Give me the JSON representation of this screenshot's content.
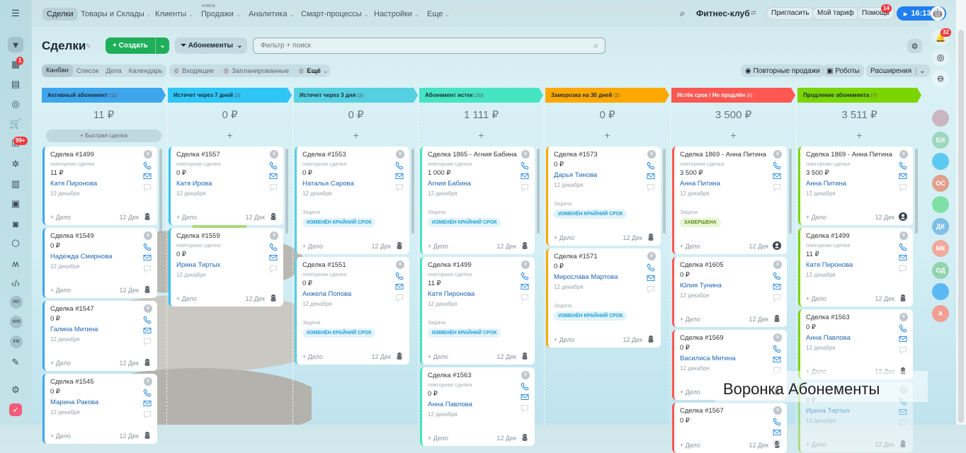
{
  "nav": {
    "items": [
      "Сделки",
      "Товары и Склады",
      "Клиенты",
      "Продажи",
      "Аналитика",
      "Смарт-процессы",
      "Настройки",
      "Еще"
    ],
    "new_tag": "НОВОЕ"
  },
  "header": {
    "org": "Фитнес-клуб",
    "invite": "Пригласить",
    "tariff": "Мой тариф",
    "help": "Помощь",
    "help_badge": "14",
    "time": "16:13",
    "bell_badge": "32"
  },
  "sidebar_left": {
    "badge1": "1",
    "badge2": "99+",
    "users": [
      "MO",
      "WW",
      "KM"
    ]
  },
  "sidebar_right": {
    "avatars": [
      {
        "text": "",
        "color": "#c9b6c0"
      },
      {
        "text": "ЕИ",
        "color": "#9ed6c0"
      },
      {
        "text": "",
        "color": "#5ec9f0"
      },
      {
        "text": "ОС",
        "color": "#e2a08c"
      },
      {
        "text": "",
        "color": "#7fe0a7"
      },
      {
        "text": "ДК",
        "color": "#7fbfe6"
      },
      {
        "text": "МК",
        "color": "#f0a99e"
      },
      {
        "text": "ОД",
        "color": "#93d3b0"
      },
      {
        "text": "",
        "color": "#5cb8f0"
      },
      {
        "text": "А",
        "color": "#f29e92"
      }
    ]
  },
  "toolbar": {
    "title": "Сделки",
    "create": "Создать",
    "funnel": "Абонементы",
    "search_placeholder": "Фильтр + поиск",
    "views": [
      "Канбан",
      "Список",
      "Дела",
      "Календарь"
    ],
    "counters": [
      {
        "n": "0",
        "label": "Входящие"
      },
      {
        "n": "0",
        "label": "Запланированные"
      },
      {
        "n": "0",
        "label": "Ещё"
      }
    ],
    "repeat_sales": "Повторные продажи",
    "robots": "Роботы",
    "extensions": "Расширения"
  },
  "columns": [
    {
      "title": "Активный абонемент",
      "count": "(11)",
      "color": "#3ea6ec",
      "text_color": "#1a2a3a",
      "total": "11 ₽",
      "quick": "+  Быстрая сделка",
      "cards": [
        {
          "title": "Сделка #1499",
          "sub": "повторная сделка",
          "amount": "11 ₽",
          "name": "Катя Пиронова",
          "date": "12 декабря"
        },
        {
          "title": "Сделка #1549",
          "amount": "0 ₽",
          "name": "Надежда Смирнова",
          "date": "12 декабря"
        },
        {
          "title": "Сделка #1547",
          "amount": "0 ₽",
          "name": "Галина Митина",
          "date": "12 декабря"
        },
        {
          "title": "Сделка #1545",
          "amount": "0 ₽",
          "name": "Марина Ракова",
          "date": "12 декабря"
        }
      ]
    },
    {
      "title": "Истечет через 7 дней",
      "count": "(2)",
      "color": "#2fc6f6",
      "text_color": "#1a2a3a",
      "total": "0 ₽",
      "cards": [
        {
          "title": "Сделка #1557",
          "sub": "повторная сделка",
          "amount": "0 ₽",
          "name": "Катя Ирова",
          "date": "12 декабря"
        },
        {
          "title": "Сделка #1559",
          "sub": "повторная сделка",
          "amount": "0 ₽",
          "name": "Ирина Тиртых",
          "date": "12 декабря"
        }
      ]
    },
    {
      "title": "Истечет через 3 дня",
      "count": "(2)",
      "color": "#55d0e0",
      "text_color": "#1a2a3a",
      "total": "0 ₽",
      "cards": [
        {
          "title": "Сделка #1553",
          "sub": "повторная сделка",
          "amount": "0 ₽",
          "name": "Наталья Сарова",
          "date": "12 декабря",
          "task_label": "Задача",
          "task": "ИЗМЕНЁН КРАЙНИЙ СРОК"
        },
        {
          "title": "Сделка #1551",
          "sub": "повторная сделка",
          "amount": "0 ₽",
          "name": "Анжела Попова",
          "date": "12 декабря",
          "task_label": "Задача",
          "task": "ИЗМЕНЁН КРАЙНИЙ СРОК"
        }
      ]
    },
    {
      "title": "Абонемент истек",
      "count": "(20)",
      "color": "#47e4c2",
      "text_color": "#1a2a3a",
      "total": "1 111 ₽",
      "cards": [
        {
          "title": "Сделка 1865 - Агния Бабина",
          "sub": "повторная сделка",
          "amount": "1 000 ₽",
          "name": "Агния Бабина",
          "date": "12 декабря",
          "task_label": "Задача",
          "task": "ИЗМЕНЁН КРАЙНИЙ СРОК"
        },
        {
          "title": "Сделка #1499",
          "sub": "повторная сделка",
          "amount": "11 ₽",
          "name": "Катя Пиронова",
          "date": "12 декабря",
          "task_label": "Задача",
          "task": "ИЗМЕНЁН КРАЙНИЙ СРОК"
        },
        {
          "title": "Сделка #1563",
          "sub": "повторная сделка",
          "amount": "0 ₽",
          "name": "Анна Павлова",
          "date": "12 декабря"
        }
      ]
    },
    {
      "title": "Заморозка на 30 дней",
      "count": "(2)",
      "color": "#ffa900",
      "text_color": "#1a2a3a",
      "total": "0 ₽",
      "cards": [
        {
          "title": "Сделка #1573",
          "amount": "0 ₽",
          "name": "Дарья Тинова",
          "date": "12 декабря",
          "task_label": "Задача",
          "task": "ИЗМЕНЁН КРАЙНИЙ СРОК"
        },
        {
          "title": "Сделка #1571",
          "amount": "0 ₽",
          "name": "Мирослава Мартова",
          "date": "12 декабря",
          "task_label": "Задача",
          "task": "ИЗМЕНЁН КРАЙНИЙ СРОК"
        }
      ]
    },
    {
      "title": "Истёк срок / Не продлён",
      "count": "(6)",
      "color": "#ff5752",
      "text_color": "#ffffff",
      "total": "3 500 ₽",
      "cards": [
        {
          "title": "Сделка 1869 - Анна Питина",
          "sub": "повторная сделка",
          "amount": "3 500 ₽",
          "name": "Анна Питина",
          "date": "12 декабря",
          "task_label": "Задача",
          "task": "ЗАВЕРШЕНА",
          "task_done": true,
          "user": true
        },
        {
          "title": "Сделка #1605",
          "amount": "0 ₽",
          "name": "Юлия Тунина",
          "date": "12 декабря"
        },
        {
          "title": "Сделка #1569",
          "amount": "0 ₽",
          "name": "Василиса Митина",
          "date": "12 декабря"
        },
        {
          "title": "Сделка #1567",
          "amount": "0 ₽",
          "name": "",
          "date": ""
        }
      ]
    },
    {
      "title": "Продление абонемента",
      "count": "(7)",
      "color": "#7bd500",
      "text_color": "#1a2a3a",
      "total": "3 511 ₽",
      "cards": [
        {
          "title": "Сделка 1869 - Анна Питина",
          "sub": "повторная сделка",
          "amount": "3 500 ₽",
          "name": "Анна Питина",
          "date": "12 декабря",
          "user": true
        },
        {
          "title": "Сделка #1499",
          "sub": "повторная сделка",
          "amount": "11 ₽",
          "name": "Катя Пиронова",
          "date": "12 декабря"
        },
        {
          "title": "Сделка #1563",
          "amount": "0 ₽",
          "name": "Анна Павлова",
          "date": "12 декабря"
        },
        {
          "title": "",
          "amount": "0 ₽",
          "name": "Ирина Тиртых",
          "date": "12 декабря"
        }
      ]
    }
  ],
  "card_common": {
    "counter": "0",
    "add_activity": "+ Дело",
    "footer_date": "12 Дек"
  },
  "overlay": {
    "text": "Воронка Абонементы"
  }
}
